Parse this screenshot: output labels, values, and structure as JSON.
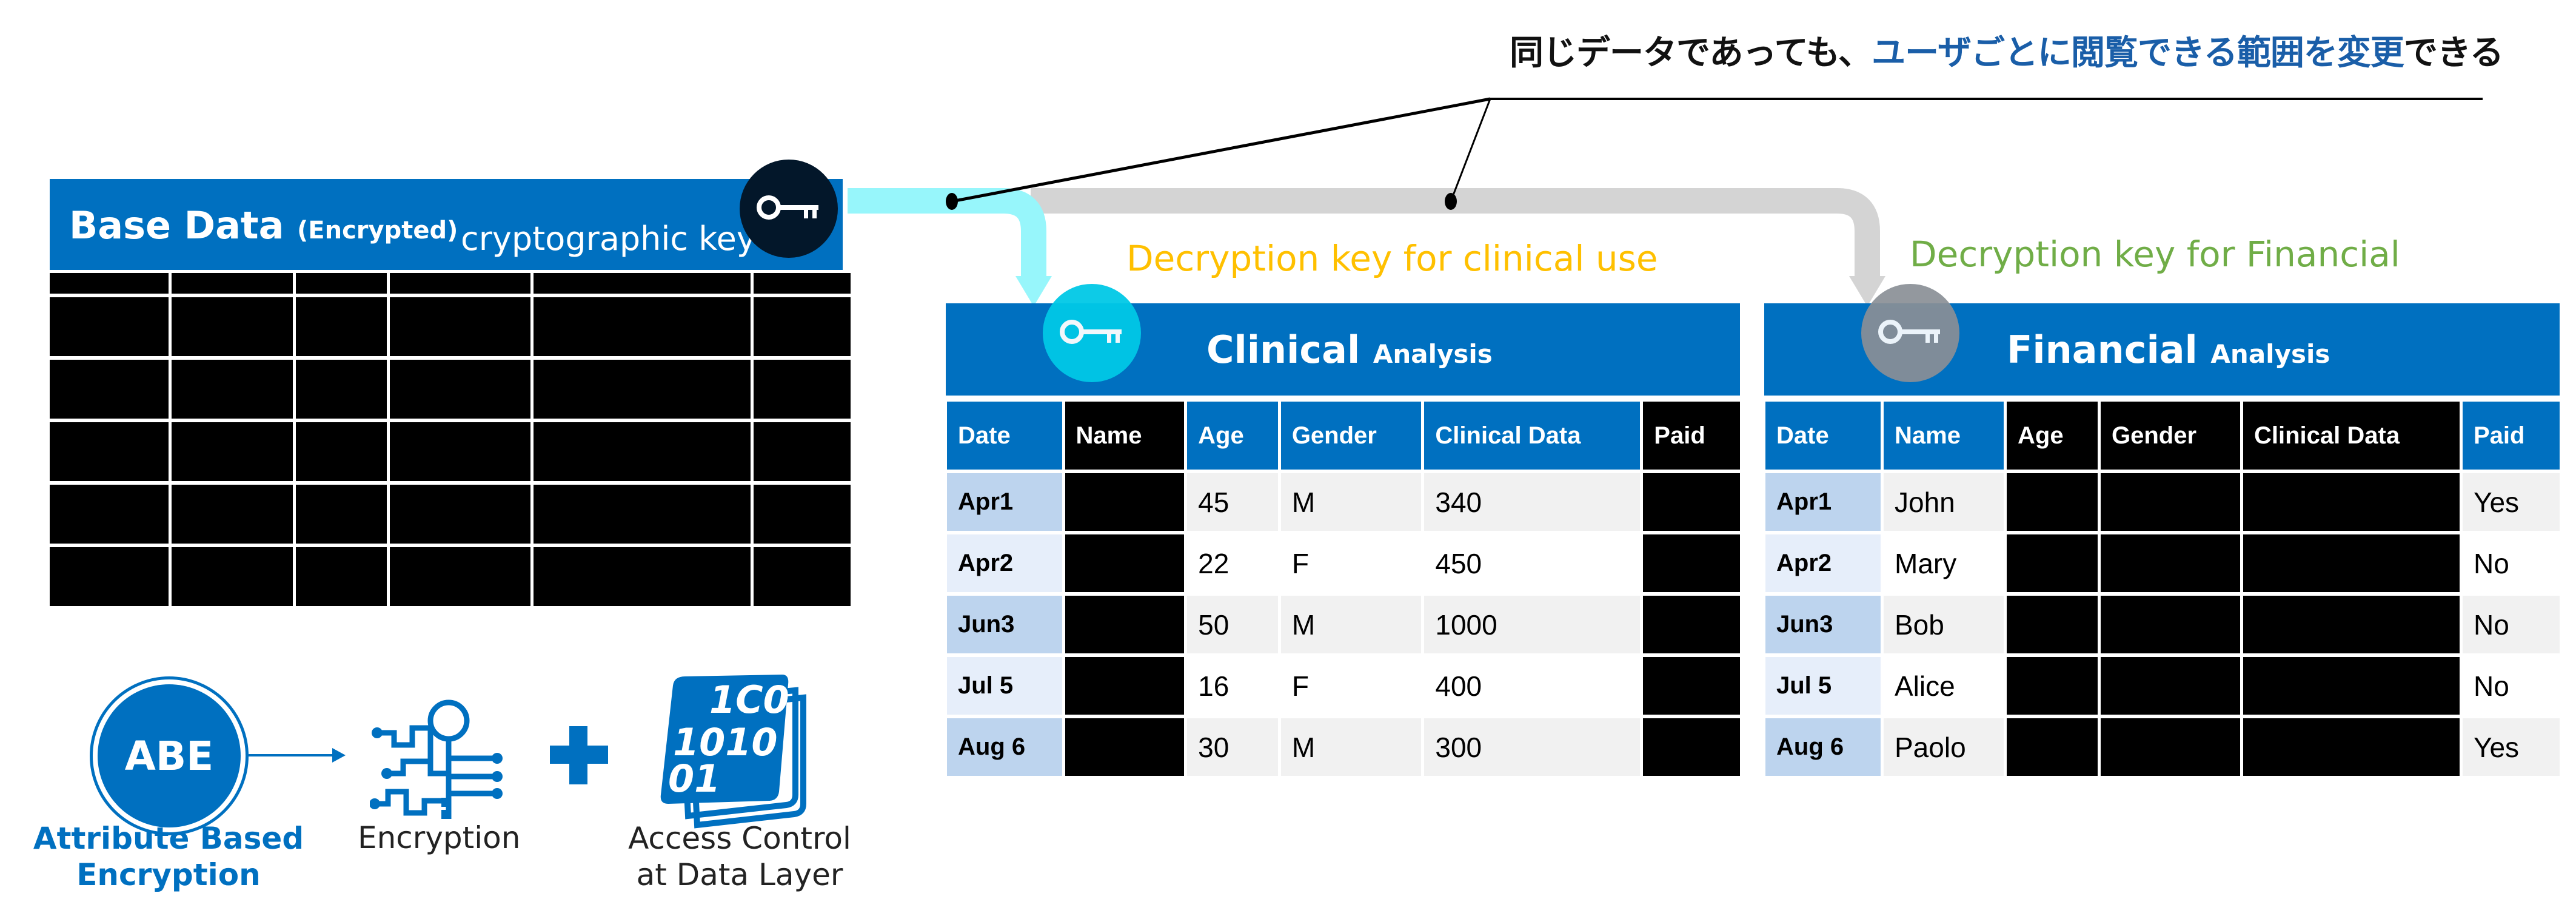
{
  "title": {
    "prefix": "同じデータであっても、",
    "highlight": "ユーザごとに閲覧できる範囲を変更",
    "suffix": "できる",
    "highlight_color": "#1a5ea8"
  },
  "base_data": {
    "title": "Base Data",
    "subtitle": "(Encrypted)",
    "key_label": "cryptographic key",
    "key_icon": "key-icon",
    "rows": 5,
    "columns": 6
  },
  "flows": {
    "clinical_color": "#97f6fb",
    "financial_color": "#d4d4d4"
  },
  "clinical": {
    "key_label": "Decryption key for clinical use",
    "key_label_color": "#ffc000",
    "title": "Clinical",
    "subtitle": "Analysis",
    "headers": [
      {
        "label": "Date",
        "masked": false
      },
      {
        "label": "Name",
        "masked": true
      },
      {
        "label": "Age",
        "masked": false
      },
      {
        "label": "Gender",
        "masked": false
      },
      {
        "label": "Clinical Data",
        "masked": false
      },
      {
        "label": "Paid",
        "masked": true
      }
    ],
    "rows": [
      [
        "Apr1",
        "",
        "45",
        "M",
        "340",
        ""
      ],
      [
        "Apr2",
        "",
        "22",
        "F",
        "450",
        ""
      ],
      [
        "Jun3",
        "",
        "50",
        "M",
        "1000",
        ""
      ],
      [
        "Jul 5",
        "",
        "16",
        "F",
        "400",
        ""
      ],
      [
        "Aug 6",
        "",
        "30",
        "M",
        "300",
        ""
      ]
    ]
  },
  "financial": {
    "key_label": "Decryption key for Financial",
    "key_label_color": "#70ad47",
    "title": "Financial",
    "subtitle": "Analysis",
    "headers": [
      {
        "label": "Date",
        "masked": false
      },
      {
        "label": "Name",
        "masked": false
      },
      {
        "label": "Age",
        "masked": true
      },
      {
        "label": "Gender",
        "masked": true
      },
      {
        "label": "Clinical Data",
        "masked": true
      },
      {
        "label": "Paid",
        "masked": false
      }
    ],
    "rows": [
      [
        "Apr1",
        "John",
        "",
        "",
        "",
        "Yes"
      ],
      [
        "Apr2",
        "Mary",
        "",
        "",
        "",
        "No"
      ],
      [
        "Jun3",
        "Bob",
        "",
        "",
        "",
        "No"
      ],
      [
        "Jul 5",
        "Alice",
        "",
        "",
        "",
        "No"
      ],
      [
        "Aug 6",
        "Paolo",
        "",
        "",
        "",
        "Yes"
      ]
    ]
  },
  "legend": {
    "abe_badge": "ABE",
    "abe_label_line1": "Attribute Based",
    "abe_label_line2": "Encryption",
    "encryption_label": "Encryption",
    "access_label_line1": "Access Control",
    "access_label_line2": "at Data Layer",
    "binary_text": [
      "1C0",
      "1010",
      "01"
    ],
    "brand_color": "#0070c0"
  }
}
